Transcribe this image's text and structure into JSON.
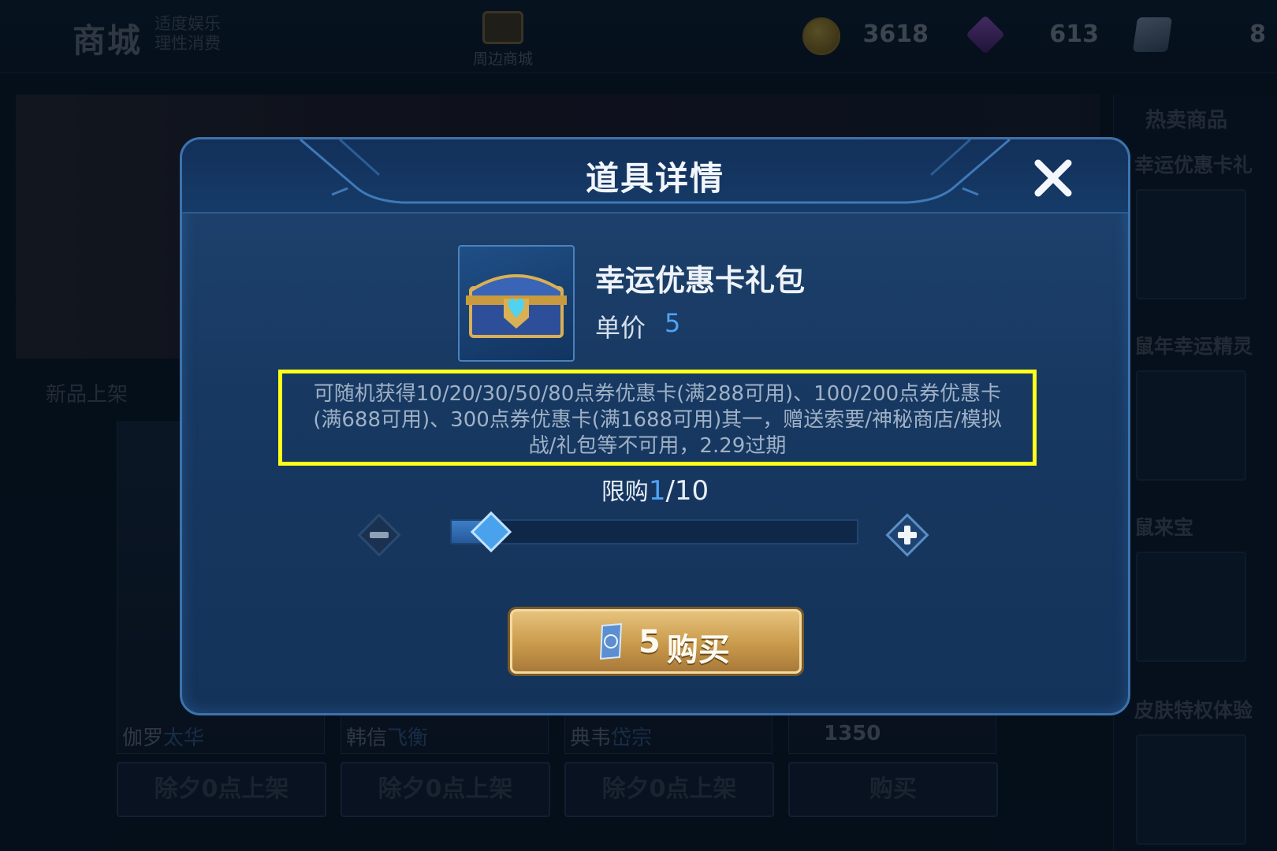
{
  "background": {
    "shop_title": "商城",
    "shop_slogan_line1": "适度娱乐",
    "shop_slogan_line2": "理性消费",
    "peripheral_shop_label": "周边商城",
    "currencies": [
      {
        "icon": "gold-coin-icon",
        "value": "3618"
      },
      {
        "icon": "diamond-icon",
        "value": "613"
      },
      {
        "icon": "voucher-icon",
        "value": "8"
      }
    ],
    "new_section_label": "新品上架",
    "cards": [
      {
        "name": "伽罗",
        "skin": "太华",
        "button": "除夕0点上架"
      },
      {
        "name": "韩信",
        "skin": "飞衡",
        "button": "除夕0点上架"
      },
      {
        "name": "典韦",
        "skin": "岱宗",
        "button": "除夕0点上架"
      },
      {
        "price": "1350",
        "button": "购买"
      }
    ],
    "sidebar": {
      "title": "热卖商品",
      "items": [
        "幸运优惠卡礼",
        "鼠年幸运精灵",
        "鼠来宝",
        "皮肤特权体验"
      ]
    }
  },
  "dialog": {
    "title": "道具详情",
    "item_name": "幸运优惠卡礼包",
    "unit_price_label": "单价",
    "unit_price_value": "5",
    "description": "可随机获得10/20/30/50/80点券优惠卡(满288可用)、100/200点券优惠卡(满688可用)、300点券优惠卡(满1688可用)其一，赠送索要/神秘商店/模拟战/礼包等不可用，2.29过期",
    "limit_label": "限购",
    "limit_current": "1",
    "limit_separator": "/",
    "limit_max": "10",
    "quantity_fraction": 0.1,
    "buy_price": "5",
    "buy_label": "购买"
  },
  "colors": {
    "highlight_box": "#ffff1a",
    "price_blue": "#4fa3f5",
    "buy_gold": "#c99a4b"
  }
}
